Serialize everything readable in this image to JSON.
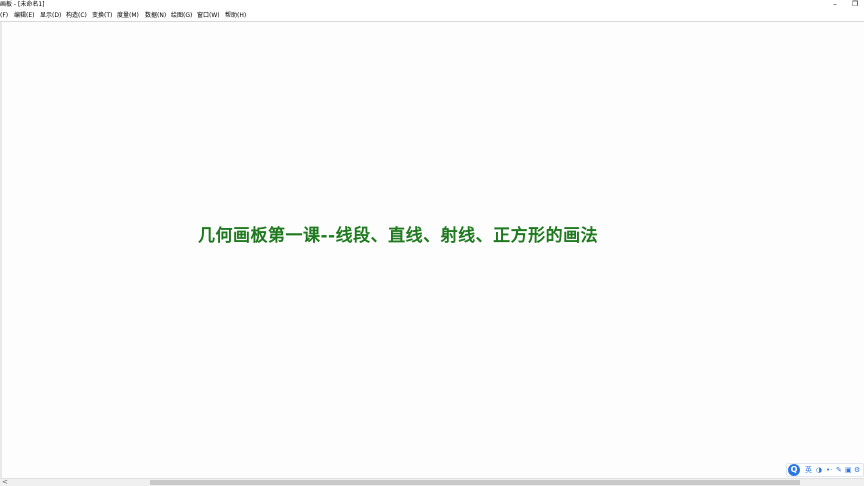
{
  "window": {
    "title": "画板 - [未命名1]",
    "restore_glyph": "❐",
    "minimize_glyph": "–"
  },
  "menubar": {
    "items": [
      {
        "label": "(F)"
      },
      {
        "label": "编辑(E)"
      },
      {
        "label": "显示(D)"
      },
      {
        "label": "构造(C)"
      },
      {
        "label": "变换(T)"
      },
      {
        "label": "度量(M)"
      },
      {
        "label": "数据(N)"
      },
      {
        "label": "绘图(G)"
      },
      {
        "label": "窗口(W)"
      },
      {
        "label": "帮助(H)"
      }
    ]
  },
  "canvas": {
    "headline": "几何画板第一课--线段、直线、射线、正方形的画法",
    "headline_color": "#1f7a1f"
  },
  "scrollbar": {
    "left_arrow": "<"
  },
  "ime": {
    "logo_glyph": "Q",
    "items": [
      {
        "label": "英",
        "icon": "lang-toggle-icon"
      },
      {
        "label": "◑",
        "icon": "moon-icon"
      },
      {
        "label": "•·",
        "icon": "punctuation-icon"
      },
      {
        "label": "✎",
        "icon": "tool-icon"
      },
      {
        "label": "▣",
        "icon": "keyboard-icon"
      },
      {
        "label": "⚙",
        "icon": "settings-icon"
      }
    ],
    "accent": "#2d78e0"
  }
}
